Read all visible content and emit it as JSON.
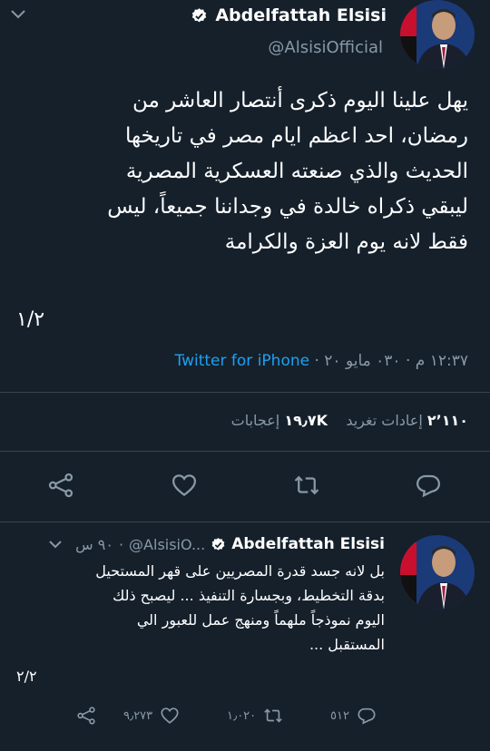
{
  "main_tweet": {
    "author_name": "Abdelfattah Elsisi",
    "handle": "@AlsisiOfficial",
    "text_lines": [
      "يهل علينا اليوم ذكرى أنتصار العاشر من",
      "رمضان، احد اعظم ايام مصر في تاريخها",
      "الحديث والذي صنعته العسكرية المصرية",
      "ليبقي ذكراه خالدة في وجداننا جميعاً، ليس",
      "فقط لانه يوم العزة والكرامة"
    ],
    "thread_count": "١/٢",
    "time": "١٢:٣٧ م",
    "date": "٠٣٠ مايو ٢٠",
    "source": "Twitter for iPhone",
    "retweets": "٢٬١١٠",
    "retweets_label": "إعادات تغريد",
    "likes": "١٩٫٧K",
    "likes_label": "إعجابات"
  },
  "reply_tweet": {
    "author_name": "Abdelfattah Elsisi",
    "handle": "@AlsisiO...",
    "time": "٩٠ س",
    "text_lines": [
      "بل لانه جسد قدرة المصريين على قهر المستحيل",
      "بدقة التخطيط، وبجسارة التنفيذ ... ليصبح ذلك",
      "اليوم نموذجاً ملهماً ومنهج عمل للعبور الي",
      "المستقبل ..."
    ],
    "thread_count": "٢/٢",
    "shares": "٩٫٢٧٣",
    "retweets": "١٫٠٢٠",
    "replies": "٥١٢"
  },
  "icons": {
    "dropdown": "chevron-down-icon",
    "verified": "verified-badge-icon",
    "share": "share-icon",
    "like": "heart-icon",
    "retweet": "retweet-icon",
    "reply": "reply-icon"
  },
  "colors": {
    "background": "#15202b",
    "divider": "#38444d",
    "secondary_text": "#8899a6",
    "link": "#1da1f2",
    "verified_badge": "#ffffff"
  }
}
